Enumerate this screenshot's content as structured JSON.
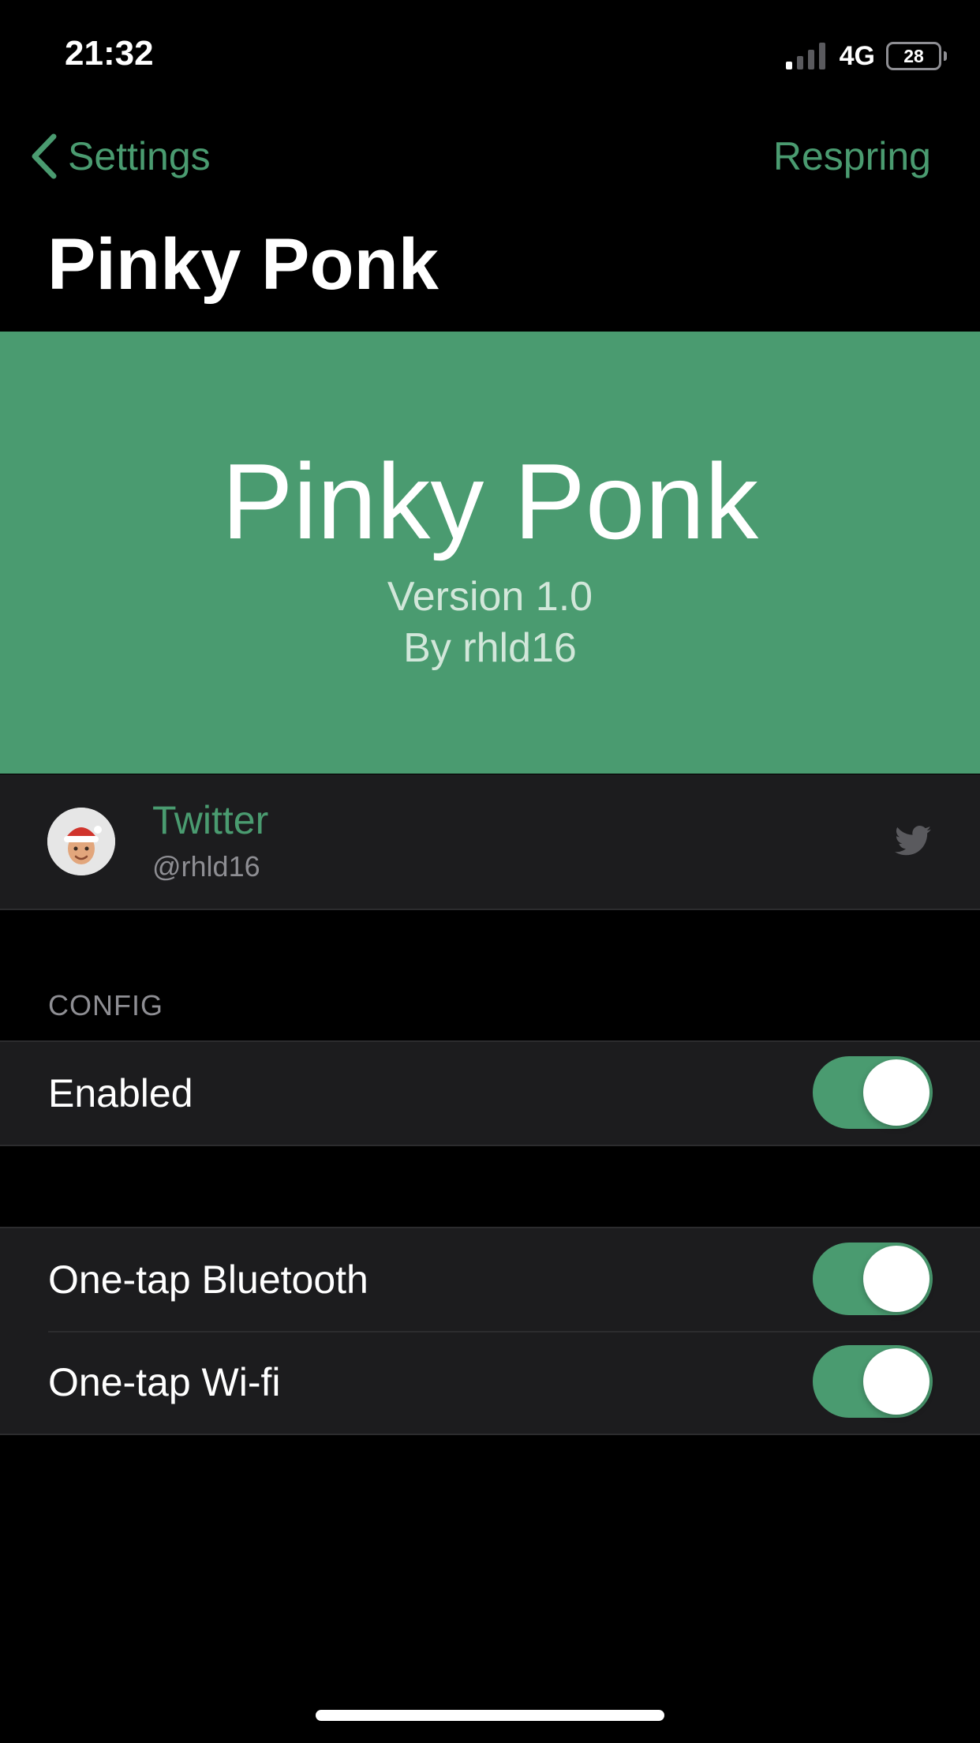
{
  "status_bar": {
    "time": "21:32",
    "network": "4G",
    "battery": "28"
  },
  "nav": {
    "back_label": "Settings",
    "action_label": "Respring",
    "title": "Pinky Ponk"
  },
  "banner": {
    "title": "Pinky Ponk",
    "version": "Version 1.0",
    "author": "By rhld16"
  },
  "twitter": {
    "title": "Twitter",
    "handle": "@rhld16",
    "icon": "twitter-bird-icon"
  },
  "config": {
    "header": "CONFIG",
    "enabled": {
      "label": "Enabled",
      "on": true
    }
  },
  "options": [
    {
      "label": "One-tap Bluetooth",
      "on": true
    },
    {
      "label": "One-tap Wi-fi",
      "on": true
    }
  ],
  "colors": {
    "accent": "#4a9b70",
    "background": "#000000",
    "cell": "#1c1c1e",
    "secondary_text": "#8e8e93"
  }
}
